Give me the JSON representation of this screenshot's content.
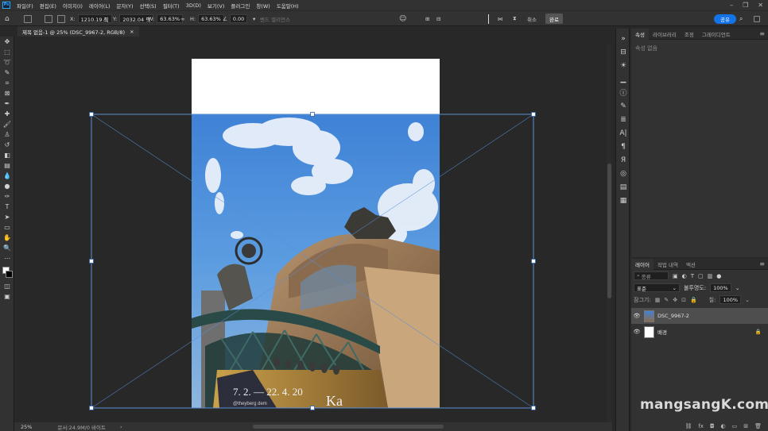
{
  "app": {
    "logo": "Ps",
    "menu": [
      "파일(F)",
      "편집(E)",
      "이미지(I)",
      "레이어(L)",
      "문자(Y)",
      "선택(S)",
      "필터(T)",
      "3D(D)",
      "보기(V)",
      "플러그인",
      "창(W)",
      "도움말(H)"
    ]
  },
  "options": {
    "x_label": "X:",
    "x_value": "1210.19 픽",
    "y_label": "Y:",
    "y_value": "2032.04 픽",
    "w_label": "W:",
    "w_value": "63.63%",
    "h_label": "H:",
    "h_value": "63.63%",
    "angle_value": "0.00",
    "interp_label": "벤드 엘리먼스",
    "cancel_label": "취소",
    "commit_label": "완료",
    "share_label": "공유"
  },
  "document": {
    "tab_title": "제목 없음-1 @ 25% (DSC_9967-2, RGB/8)",
    "close_glyph": "×",
    "sign_text_1": "7. 2. — 22. 4. 20",
    "sign_text_2": "Ka",
    "sign_text_3": "@theyberg dem"
  },
  "status": {
    "zoom": "25%",
    "doc_info": "문서:24.9M/0 바이트"
  },
  "properties_panel": {
    "tabs": [
      "속성",
      "라이브러리",
      "조정",
      "그레이디언트"
    ],
    "active_tab": 0,
    "empty_text": "속성 없음"
  },
  "layers_panel": {
    "tabs": [
      "레이어",
      "작업 내역",
      "액션"
    ],
    "active_tab": 0,
    "kind_label": "종류",
    "blend_mode": "표준",
    "opacity_label": "불투명도:",
    "opacity_value": "100%",
    "lock_label": "잠그기:",
    "fill_label": "칠:",
    "fill_value": "100%",
    "layers": [
      {
        "name": "DSC_9967-2",
        "selected": true
      },
      {
        "name": "배경",
        "selected": false,
        "locked": true
      }
    ],
    "footer_icons": [
      "link-icon",
      "fx-icon",
      "mask-icon",
      "adjustment-icon",
      "group-icon",
      "new-layer-icon",
      "trash-icon"
    ]
  },
  "watermark": "mangsangK.com",
  "colors": {
    "accent": "#1473e6",
    "panel_bg": "#323232",
    "canvas_bg": "#282828",
    "selection_blue": "#4a7fc7"
  }
}
